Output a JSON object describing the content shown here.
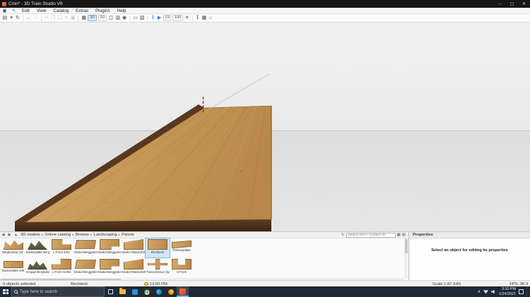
{
  "window": {
    "title": "Cmn* - 3D Train Studio V6",
    "minimize": "─",
    "maximize": "▢",
    "close": "✕"
  },
  "menu": {
    "icon1": "▣",
    "icon2": "✎",
    "items": [
      "Edit",
      "View",
      "Catalog",
      "Extras",
      "Plugins",
      "Help"
    ]
  },
  "toolbar": {
    "items": [
      {
        "name": "save",
        "glyph": "▤"
      },
      {
        "name": "save-options",
        "glyph": "▾"
      },
      {
        "name": "refresh",
        "glyph": "↻"
      },
      {
        "name": "undo",
        "glyph": "←"
      },
      {
        "name": "redo",
        "glyph": "→"
      },
      {
        "name": "cut",
        "glyph": "✂"
      },
      {
        "name": "copy",
        "glyph": "❐"
      },
      {
        "name": "paste",
        "glyph": "❑"
      },
      {
        "name": "delete",
        "glyph": "✕"
      },
      {
        "name": "duplicate",
        "glyph": "▣"
      },
      {
        "name": "grid",
        "glyph": "▦"
      },
      {
        "name": "view-3d",
        "glyph": "3D"
      },
      {
        "name": "view-2d",
        "glyph": "2D"
      },
      {
        "name": "split-view",
        "glyph": "◫"
      },
      {
        "name": "layers",
        "glyph": "▥"
      },
      {
        "name": "camera",
        "glyph": "◉"
      },
      {
        "name": "page",
        "glyph": "▭"
      },
      {
        "name": "surface",
        "glyph": "▧"
      },
      {
        "name": "pause",
        "glyph": "‖"
      },
      {
        "name": "play",
        "glyph": "▶"
      },
      {
        "name": "speed-low",
        "glyph": "19"
      },
      {
        "name": "speed-high",
        "glyph": "100"
      },
      {
        "name": "stop",
        "glyph": "✕"
      },
      {
        "name": "download",
        "glyph": "↧"
      },
      {
        "name": "grid-2",
        "glyph": "▦"
      },
      {
        "name": "sound",
        "glyph": "♪"
      }
    ]
  },
  "catalog": {
    "nav_back": "◀",
    "nav_forward": "▶",
    "nav_up": "▲",
    "breadcrumb": [
      "3D models",
      "Online catalog",
      "Browse",
      "Landscaping",
      "Panels"
    ],
    "separator": "▸",
    "refresh": "↻",
    "search_placeholder": "Search term / Content ID",
    "view_grid": "▦",
    "view_list": "▤",
    "items": [
      {
        "label": "Bergkulisse (16 ..."
      },
      {
        "label": "Bodenplatte Berg..."
      },
      {
        "label": "L-Form links"
      },
      {
        "label": "Modul Berggarten..."
      },
      {
        "label": "Modul Berggarten..."
      },
      {
        "label": "Modul Wasserfall ..."
      },
      {
        "label": "Rechteck",
        "selected": true
      },
      {
        "label": "Trassenplatte"
      },
      {
        "label": "Bodenplatte 400 x..."
      },
      {
        "label": "Gruppe Bergkulis..."
      },
      {
        "label": "L-Form rechts"
      },
      {
        "label": "Modul Berggarten..."
      },
      {
        "label": "Modul Berggarten..."
      },
      {
        "label": "Modul Wasserfall ..."
      },
      {
        "label": "Trassenkreuz (Spi..."
      },
      {
        "label": "U-Form"
      }
    ]
  },
  "properties": {
    "title": "Properties",
    "empty_message": "Select an object for editing its properties"
  },
  "statusbar": {
    "selection": "0 objects selected",
    "item": "Rechteck",
    "sim_time": "12:00 PM",
    "scale": "Scale 1:87 (H0)",
    "fps": "FPS: 36.9"
  },
  "taskbar": {
    "search_placeholder": "Type here to search",
    "clock_time": "3:10 PM",
    "clock_date": "1/24/2021",
    "tray_caret": "∧"
  },
  "colors": {
    "wood": "#c69a58",
    "wood_edge": "#59381f",
    "accent_blue": "#2f7fd6",
    "selection": "#cfe5f8"
  }
}
